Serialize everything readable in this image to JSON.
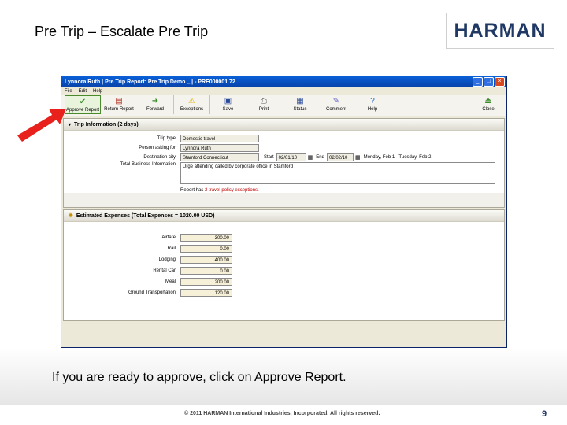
{
  "slide": {
    "title": "Pre Trip – Escalate Pre Trip",
    "logo_text": "HARMAN",
    "caption": "If you are ready to approve, click on Approve Report.",
    "copyright": "© 2011 HARMAN International Industries, Incorporated. All rights reserved.",
    "page_number": "9"
  },
  "window": {
    "title": "Lynnora Ruth | Pre Trip Report: Pre Trip Demo _ | - PRE000001 72",
    "menu": [
      "File",
      "Edit",
      "Help"
    ],
    "toolbar": [
      {
        "label": "Approve Report",
        "icon": "approve-icon"
      },
      {
        "label": "Return Report",
        "icon": "return-report-icon"
      },
      {
        "label": "Forward",
        "icon": "forward-icon"
      },
      {
        "label": "Exceptions",
        "icon": "warning-icon"
      },
      {
        "label": "Save",
        "icon": "save-icon"
      },
      {
        "label": "Print",
        "icon": "print-icon"
      },
      {
        "label": "Status",
        "icon": "status-icon"
      },
      {
        "label": "Comment",
        "icon": "comment-icon"
      },
      {
        "label": "Help",
        "icon": "help-icon"
      },
      {
        "label": "Close",
        "icon": "close-report-icon"
      }
    ]
  },
  "trip_info": {
    "header": "Trip Information (2 days)",
    "trip_type_label": "Trip type",
    "trip_type_value": "Domestic travel",
    "person_label": "Person asking for",
    "person_value": "Lynnora Ruth",
    "destination_label": "Destination city",
    "destination_value": "Stamford Connecticut",
    "start_label": "Start",
    "start_value": "02/01/10",
    "end_label": "End",
    "end_value": "02/02/10",
    "date_range": "Monday, Feb 1 - Tuesday, Feb 2",
    "purpose_label": "Total Business Information",
    "purpose_value": "Urge attending called by corporate office in Stamford",
    "policy_prefix": "Report has",
    "policy_link": "2 travel policy exceptions."
  },
  "expenses": {
    "header": "Estimated Expenses (Total Expenses = 1020.00 USD)",
    "items": [
      {
        "label": "Airfare",
        "value": "300.00"
      },
      {
        "label": "Rail",
        "value": "0.00"
      },
      {
        "label": "Lodging",
        "value": "400.00"
      },
      {
        "label": "Rental Car",
        "value": "0.00"
      },
      {
        "label": "Meal",
        "value": "200.00"
      },
      {
        "label": "Ground Transportation",
        "value": "120.00"
      }
    ]
  },
  "colors": {
    "arrow": "#e8211d",
    "logo": "#1f3864",
    "titlebar": "#0a5fd8"
  }
}
